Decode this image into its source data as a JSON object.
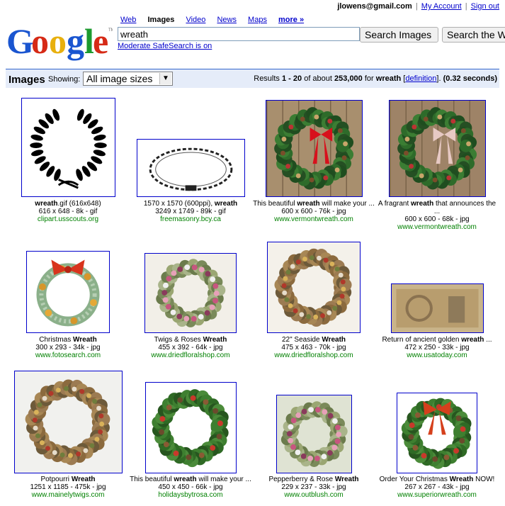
{
  "user": {
    "email": "jlowens@gmail.com",
    "my_account": "My Account",
    "sign_out": "Sign out"
  },
  "nav": {
    "web": "Web",
    "images": "Images",
    "video": "Video",
    "news": "News",
    "maps": "Maps",
    "more": "more »"
  },
  "search": {
    "query": "wreath",
    "search_images": "Search Images",
    "search_web": "Search the Web",
    "safesearch": "Moderate SafeSearch is on"
  },
  "bar": {
    "title": "Images",
    "showing": "Showing:",
    "size_selected": "All image sizes",
    "results_prefix": "Results",
    "results_range": "1 - 20",
    "results_mid": "of about",
    "results_total": "253,000",
    "results_for": "for",
    "results_query": "wreath",
    "definition": "definition",
    "results_time": "(0.32 seconds)"
  },
  "results": [
    {
      "cap_pre": "",
      "cap_bold": "wreath",
      "cap_post": ".gif (616x648)",
      "meta": "616 x 648 - 8k - gif",
      "src": "clipart.usscouts.org",
      "icon": "laurel-wreath-silhouette"
    },
    {
      "cap_pre": "1570 x 1570 (600ppi), ",
      "cap_bold": "wreath",
      "cap_post": "",
      "meta": "3249 x 1749 - 89k - gif",
      "src": "freemasonry.bcy.ca",
      "icon": "wreath-line-drawing"
    },
    {
      "cap_pre": "This beautiful ",
      "cap_bold": "wreath",
      "cap_post": " will make your ...",
      "meta": "600 x 600 - 76k - jpg",
      "src": "www.vermontwreath.com",
      "icon": "wreath-red-bow"
    },
    {
      "cap_pre": "A fragrant ",
      "cap_bold": "wreath",
      "cap_post": " that announces the ...",
      "meta": "600 x 600 - 68k - jpg",
      "src": "www.vermontwreath.com",
      "icon": "wreath-plaid-bow"
    },
    {
      "cap_pre": "Christmas ",
      "cap_bold": "Wreath",
      "cap_post": "",
      "meta": "300 x 293 - 34k - jpg",
      "src": "www.fotosearch.com",
      "icon": "wreath-cartoon-bells"
    },
    {
      "cap_pre": "Twigs & Roses ",
      "cap_bold": "Wreath",
      "cap_post": "",
      "meta": "455 x 392 - 64k - jpg",
      "src": "www.driedfloralshop.com",
      "icon": "wreath-twigs-roses"
    },
    {
      "cap_pre": "22\" Seaside ",
      "cap_bold": "Wreath",
      "cap_post": "",
      "meta": "475 x 463 - 70k - jpg",
      "src": "www.driedfloralshop.com",
      "icon": "wreath-seaside"
    },
    {
      "cap_pre": "Return of ancient golden ",
      "cap_bold": "wreath",
      "cap_post": " ...",
      "meta": "472 x 250 - 33k - jpg",
      "src": "www.usatoday.com",
      "icon": "stone-carving"
    },
    {
      "cap_pre": "Potpourri ",
      "cap_bold": "Wreath",
      "cap_post": "",
      "meta": "1251 x 1185 - 475k - jpg",
      "src": "www.mainelytwigs.com",
      "icon": "wreath-potpourri"
    },
    {
      "cap_pre": "This beautiful ",
      "cap_bold": "wreath",
      "cap_post": " will make your ...",
      "meta": "450 x 450 - 66k - jpg",
      "src": "holidaysbytrosa.com",
      "icon": "wreath-pinecones"
    },
    {
      "cap_pre": "Pepperberry & Rose ",
      "cap_bold": "Wreath",
      "cap_post": "",
      "meta": "229 x 237 - 33k - jpg",
      "src": "www.outblush.com",
      "icon": "wreath-pepperberry-rose"
    },
    {
      "cap_pre": "Order Your Christmas ",
      "cap_bold": "Wreath",
      "cap_post": " NOW!",
      "meta": "267 x 267 - 43k - jpg",
      "src": "www.superiorwreath.com",
      "icon": "wreath-orange-bow"
    }
  ]
}
